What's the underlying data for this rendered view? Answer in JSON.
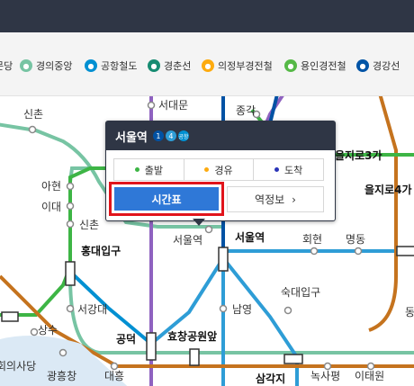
{
  "legend": [
    {
      "label": "문당",
      "color": "#7ca8d5",
      "icon": "line-icon"
    },
    {
      "label": "경의중앙",
      "color": "#77c4a3",
      "icon": "line-icon"
    },
    {
      "label": "공항철도",
      "color": "#0090d2",
      "icon": "line-icon"
    },
    {
      "label": "경춘선",
      "color": "#178c72",
      "icon": "line-icon"
    },
    {
      "label": "의정부경전철",
      "color": "#fdab10",
      "icon": "line-icon"
    },
    {
      "label": "용인경전철",
      "color": "#56b947",
      "icon": "line-icon"
    },
    {
      "label": "경강선",
      "color": "#0054a6",
      "icon": "line-icon"
    }
  ],
  "stations": {
    "sinchon_top": "신촌",
    "seodaemun": "서대문",
    "jonggak": "종각",
    "euljiro3": "을지로3가",
    "euljiro4": "을지로4가",
    "ahyeon": "아현",
    "idae": "이대",
    "sinchon": "신촌",
    "hongdae": "홍대입구",
    "seoul_station_small": "서울역",
    "seoul_station": "서울역",
    "hoehyeon": "회현",
    "myeongdong": "명동",
    "sookmyung": "숙대입구",
    "seogangdae": "서강대",
    "namyeong": "남영",
    "sangsu": "상수",
    "gongdeok": "공덕",
    "hyochang": "효창공원앞",
    "dong": "동",
    "uisadang": "회의사당",
    "gwangheungchang": "광흥창",
    "daeheung": "대흥",
    "samgakji": "삼각지",
    "noksapyeong": "녹사평",
    "itaewon": "이태원"
  },
  "popup": {
    "title": "서울역",
    "badges": [
      "1",
      "4",
      "공항"
    ],
    "tabs": [
      "출발",
      "경유",
      "도착"
    ],
    "timetable_label": "시간표",
    "info_label": "역정보"
  },
  "colors": {
    "line1": "#0052a4",
    "line2": "#3db545",
    "line4": "#2e9dd6",
    "line5": "#8f62c0",
    "line6": "#c5731e",
    "gyeongui": "#77c4a3",
    "airport": "#0090d2",
    "highlight": "#e1141b",
    "button": "#2f78d7",
    "header": "#2f3645"
  }
}
